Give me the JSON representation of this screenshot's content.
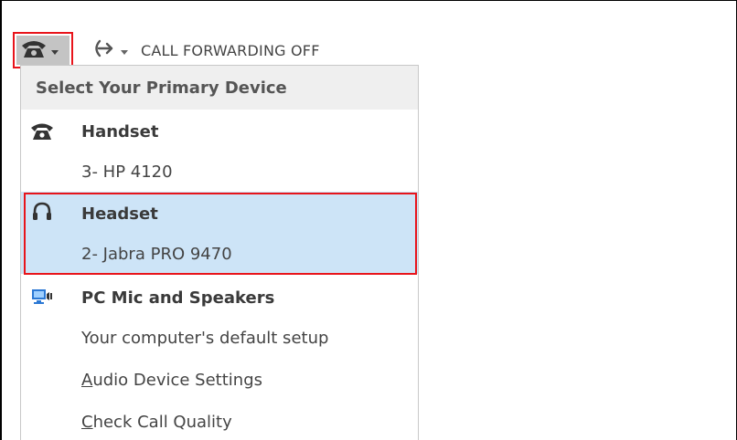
{
  "toolbar": {
    "device_icon": "phone-icon",
    "forward_icon": "call-forward-arrow-icon",
    "forwarding_label": "CALL FORWARDING OFF"
  },
  "menu": {
    "header": "Select Your Primary Device",
    "devices": [
      {
        "icon": "handset-icon",
        "name": "Handset",
        "detail": "3- HP 4120",
        "selected": false
      },
      {
        "icon": "headset-icon",
        "name": "Headset",
        "detail": "2- Jabra PRO 9470",
        "selected": true
      },
      {
        "icon": "pc-speakers-icon",
        "name": "PC Mic and Speakers",
        "detail": "Your computer's default setup",
        "selected": false
      }
    ],
    "audio_settings": {
      "first": "A",
      "rest": "udio Device Settings"
    },
    "check_quality": {
      "first": "C",
      "rest": "heck Call Quality"
    }
  },
  "colors": {
    "highlight_border": "#e8141b",
    "selected_background": "#cde4f7",
    "header_background": "#efefef",
    "button_background": "#c4c4c4"
  }
}
